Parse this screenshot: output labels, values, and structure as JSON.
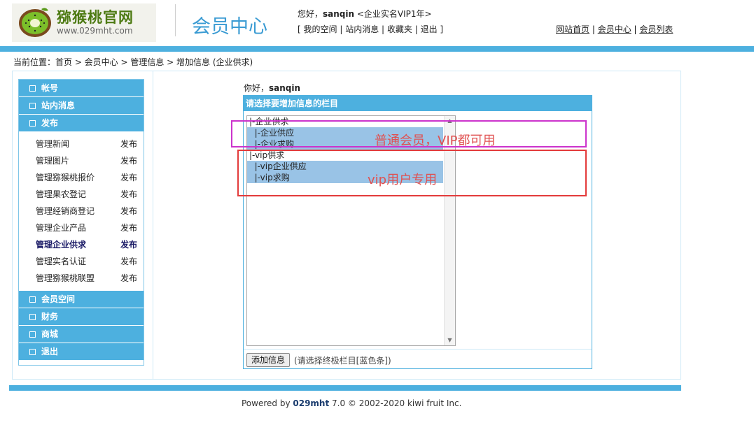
{
  "header": {
    "logo_title": "猕猴桃官网",
    "logo_url": "www.029mht.com",
    "section_title": "会员中心",
    "greeting_prefix": "您好，",
    "username": "sanqin",
    "user_level": " <企业实名VIP1年>",
    "user_links": [
      "我的空间",
      "站内消息",
      "收藏夹",
      "退出"
    ],
    "site_links": [
      "网站首页",
      "会员中心",
      "会员列表"
    ]
  },
  "breadcrumb": "当前位置：首页 > 会员中心 > 管理信息 > 增加信息 (企业供求)",
  "menu": {
    "heads_top": [
      "帐号",
      "站内消息",
      "发布"
    ],
    "publish_items": [
      {
        "name": "管理新闻",
        "action": "发布"
      },
      {
        "name": "管理图片",
        "action": "发布"
      },
      {
        "name": "管理猕猴桃报价",
        "action": "发布"
      },
      {
        "name": "管理果农登记",
        "action": "发布"
      },
      {
        "name": "管理经销商登记",
        "action": "发布"
      },
      {
        "name": "管理企业产品",
        "action": "发布"
      },
      {
        "name": "管理企业供求",
        "action": "发布"
      },
      {
        "name": "管理实名认证",
        "action": "发布"
      },
      {
        "name": "管理猕猴桃联盟",
        "action": "发布"
      }
    ],
    "heads_bottom": [
      "会员空间",
      "财务",
      "商城",
      "退出"
    ]
  },
  "content": {
    "hello_prefix": "你好，",
    "hello_user": "sanqin",
    "panel_title": "请选择要增加信息的栏目",
    "options": [
      {
        "label": "|-企业供求",
        "selected": false
      },
      {
        "label": "  |-企业供应",
        "selected": true
      },
      {
        "label": "  |-企业求购",
        "selected": true
      },
      {
        "label": "|-vip供求",
        "selected": false
      },
      {
        "label": "  |-vip企业供应",
        "selected": true
      },
      {
        "label": "  |-vip求购",
        "selected": true
      }
    ],
    "add_button": "添加信息",
    "hint": "(请选择终极栏目[蓝色条])"
  },
  "annotations": {
    "text1": "普通会员，VIP都可用",
    "text2": "vip用户专用",
    "color1": "#cc33cc",
    "color2": "#e33b3b"
  },
  "footer": {
    "prefix": "Powered by ",
    "brand": "029mht",
    "rest": " 7.0  © 2002-2020 kiwi fruit Inc."
  },
  "colors": {
    "accent": "#4db0df",
    "selected": "#99c3e6"
  }
}
